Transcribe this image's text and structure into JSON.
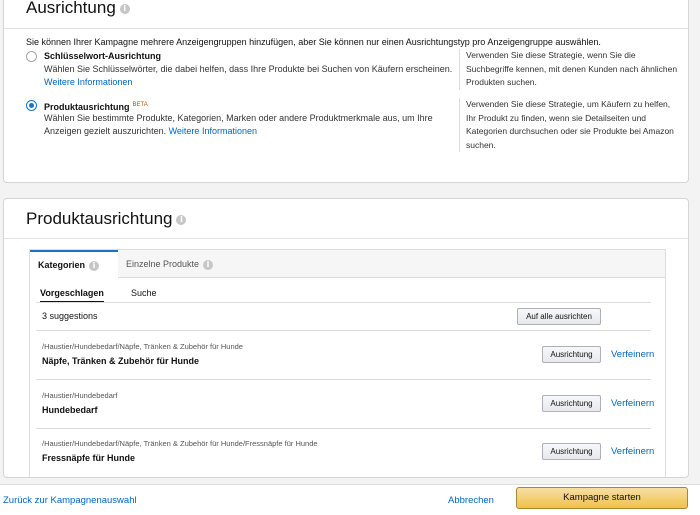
{
  "targeting": {
    "title": "Ausrichtung",
    "intro": "Sie können Ihrer Kampagne mehrere Anzeigengruppen hinzufügen, aber Sie können nur einen Ausrichtungstyp pro Anzeigengruppe auswählen.",
    "options": [
      {
        "title": "Schlüsselwort-Ausrichtung",
        "badge": "",
        "desc": "Wählen Sie Schlüsselwörter, die dabei helfen, dass Ihre Produkte bei Suchen von Käufern erscheinen.",
        "link": "Weitere Informationen",
        "selected": false,
        "side": "Verwenden Sie diese Strategie, wenn Sie die Suchbegriffe kennen, mit denen Kunden nach ähnlichen Produkten suchen."
      },
      {
        "title": "Produktausrichtung",
        "badge": "BETA",
        "desc": "Wählen Sie bestimmte Produkte, Kategorien, Marken oder andere Produktmerkmale aus, um Ihre Anzeigen gezielt auszurichten.",
        "link": "Weitere Informationen",
        "selected": true,
        "side": "Verwenden Sie diese Strategie, um Käufern zu helfen, Ihr Produkt zu finden, wenn sie Detailseiten und Kategorien durchsuchen oder sie Produkte bei Amazon suchen."
      }
    ]
  },
  "product_targeting": {
    "title": "Produktausrichtung",
    "tabs": [
      "Kategorien",
      "Einzelne Produkte"
    ],
    "subtabs": [
      "Vorgeschlagen",
      "Suche"
    ],
    "count_label": "3 suggestions",
    "target_all_label": "Auf alle ausrichten",
    "target_label": "Ausrichtung",
    "refine_label": "Verfeinern",
    "rows": [
      {
        "path": "/Haustier/Hundebedarf/Näpfe, Tränken & Zubehör für Hunde",
        "name": "Näpfe, Tränken & Zubehör für Hunde"
      },
      {
        "path": "/Haustier/Hundebedarf",
        "name": "Hundebedarf"
      },
      {
        "path": "/Haustier/Hundebedarf/Näpfe, Tränken & Zubehör für Hunde/Fressnäpfe für Hunde",
        "name": "Fressnäpfe für Hunde"
      }
    ]
  },
  "footer": {
    "back_label": "Zurück zur Kampagnenauswahl",
    "cancel_label": "Abbrechen",
    "start_label": "Kampagne starten"
  }
}
